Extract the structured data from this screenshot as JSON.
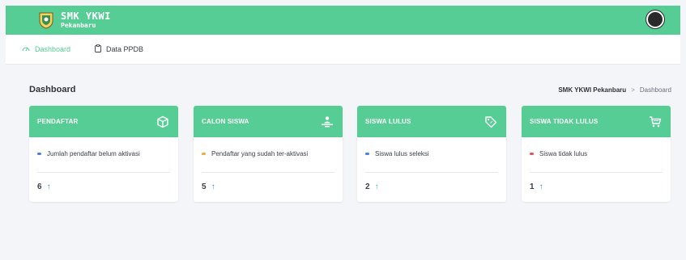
{
  "app": {
    "name": "SMK YKWI",
    "subtitle": "Pekanbaru"
  },
  "nav": {
    "items": [
      {
        "label": "Dashboard",
        "icon": "gauge-icon",
        "active": true
      },
      {
        "label": "Data PPDB",
        "icon": "clipboard-icon",
        "active": false
      }
    ]
  },
  "page": {
    "title": "Dashboard",
    "breadcrumb": {
      "link": "SMK YKWI Pekanbaru",
      "separator": ">",
      "current": "Dashboard"
    }
  },
  "colors": {
    "accent": "#55cd95",
    "blue": "#4a7fe8",
    "orange": "#f0a94a",
    "red": "#e8515a",
    "teal": "#3fc8a0"
  },
  "cards": [
    {
      "title": "PENDAFTAR",
      "icon": "box-icon",
      "desc": "Jumlah pendaftar belum aktivasi",
      "dot_color": "#4a7fe8",
      "count": "6",
      "arrow": "↑",
      "arrow_color": "#4a7fe8"
    },
    {
      "title": "CALON SISWA",
      "icon": "person-desk-icon",
      "desc": "Pendaftar yang sudah ter-aktivasi",
      "dot_color": "#f0a94a",
      "count": "5",
      "arrow": "↑",
      "arrow_color": "#4a7fe8"
    },
    {
      "title": "SISWA LULUS",
      "icon": "tag-icon",
      "desc": "Siswa lulus seleksi",
      "dot_color": "#4a7fe8",
      "count": "2",
      "arrow": "↑",
      "arrow_color": "#3fc8a0"
    },
    {
      "title": "SISWA TIDAK LULUS",
      "icon": "cart-icon",
      "desc": "Siswa tidak lulus",
      "dot_color": "#e8515a",
      "count": "1",
      "arrow": "↑",
      "arrow_color": "#4a7fe8"
    }
  ]
}
